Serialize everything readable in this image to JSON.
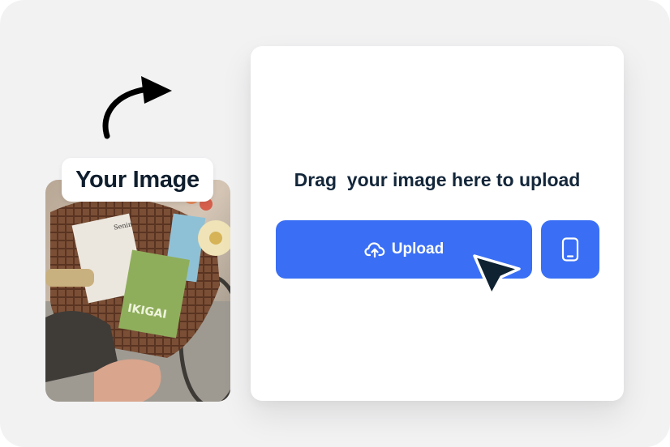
{
  "badge": {
    "label": "Your Image"
  },
  "upload_card": {
    "instruction": "Drag  your image here to upload",
    "upload_button_label": "Upload",
    "upload_icon": "cloud-upload-icon",
    "device_icon": "smartphone-icon"
  },
  "decor": {
    "arrow_icon": "curved-arrow-icon",
    "cursor_icon": "pointer-cursor-icon"
  },
  "colors": {
    "background": "#f2f2f3",
    "accent": "#3a6ff5",
    "text_dark": "#13263a",
    "cursor_fill": "#0f2232",
    "arrow": "#000000"
  }
}
